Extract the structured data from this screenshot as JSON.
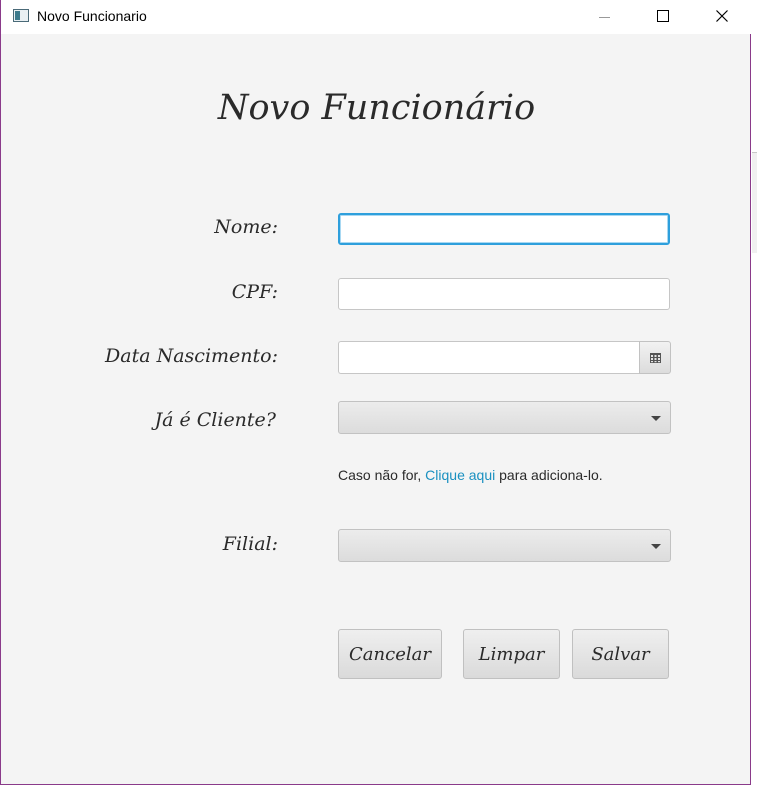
{
  "window": {
    "title": "Novo Funcionario"
  },
  "form": {
    "heading": "Novo Funcionário",
    "fields": {
      "nome": {
        "label": "Nome:",
        "value": ""
      },
      "cpf": {
        "label": "CPF:",
        "value": ""
      },
      "data_nascimento": {
        "label": "Data Nascimento:",
        "value": ""
      },
      "ja_cliente": {
        "label": "Já é Cliente?",
        "selected": ""
      },
      "filial": {
        "label": "Filial:",
        "selected": ""
      }
    },
    "hint": {
      "prefix": "Caso não for, ",
      "link": "Clique aqui",
      "suffix": " para adiciona-lo."
    },
    "buttons": {
      "cancel": "Cancelar",
      "clear": "Limpar",
      "save": "Salvar"
    }
  },
  "icons": [
    "app-icon",
    "minimize-icon",
    "maximize-icon",
    "close-icon",
    "calendar-icon",
    "chevron-down-icon"
  ],
  "colors": {
    "focus_border": "#2e9fdc",
    "link": "#1a90c0",
    "window_border": "#8a3a8a"
  }
}
